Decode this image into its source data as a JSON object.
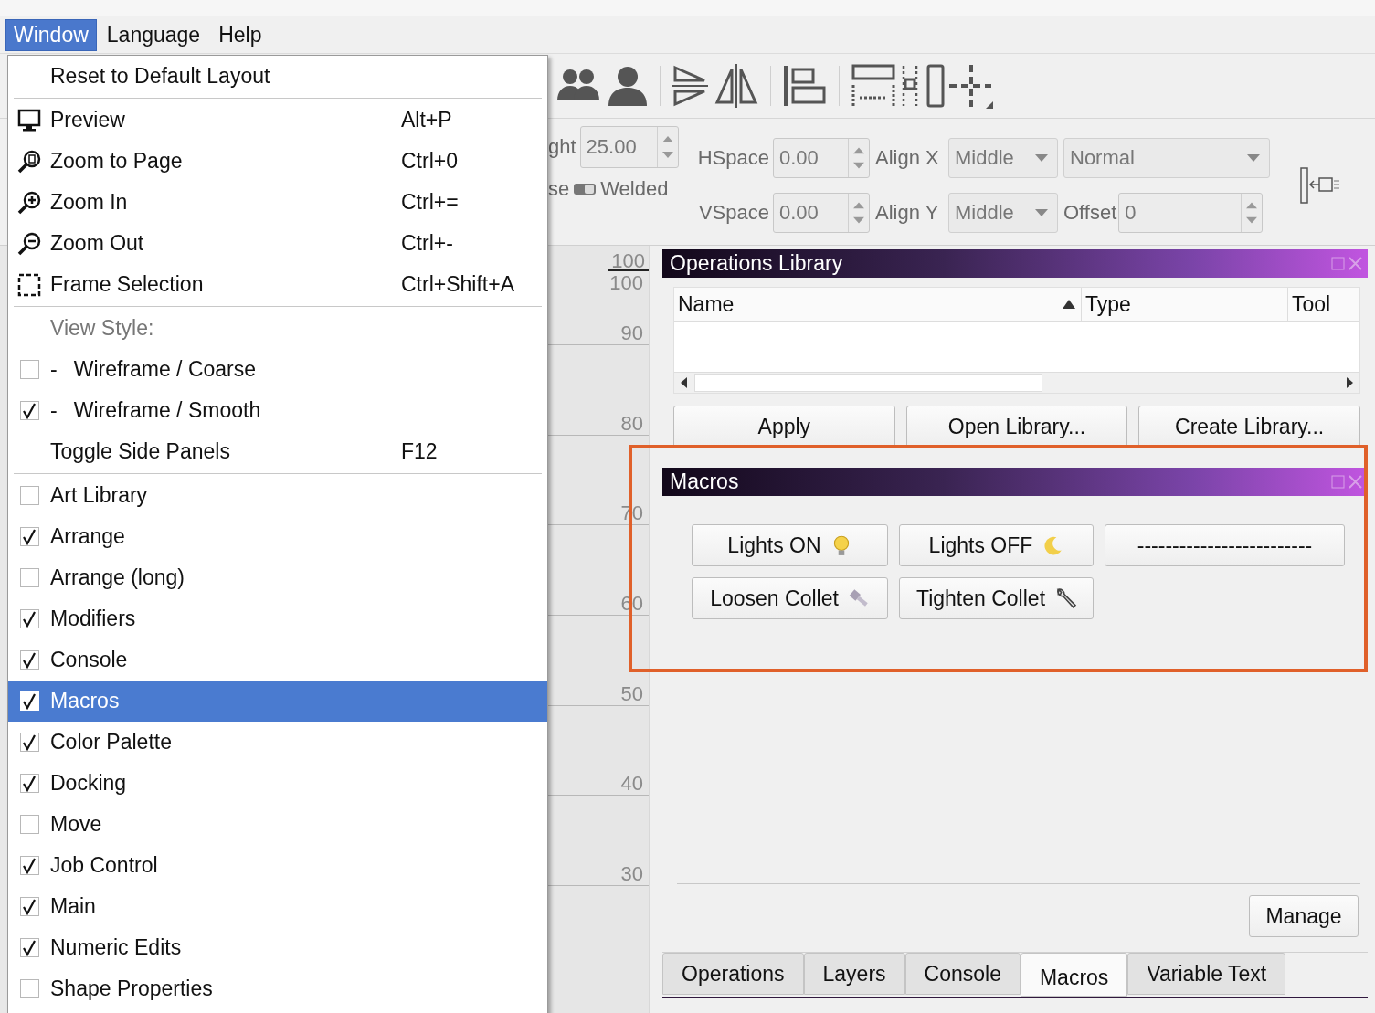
{
  "menubar": [
    {
      "label": "Window",
      "selected": true
    },
    {
      "label": "Language",
      "selected": false
    },
    {
      "label": "Help",
      "selected": false
    }
  ],
  "window_menu": {
    "items": [
      {
        "kind": "action",
        "label": "Reset to Default Layout",
        "selected": false
      },
      {
        "kind": "separator"
      },
      {
        "kind": "action",
        "label": "Preview",
        "shortcut": "Alt+P",
        "selected": false
      },
      {
        "kind": "action",
        "label": "Zoom to Page",
        "shortcut": "Ctrl+0",
        "selected": false
      },
      {
        "kind": "action",
        "label": "Zoom In",
        "shortcut": "Ctrl+=",
        "selected": false
      },
      {
        "kind": "action",
        "label": "Zoom Out",
        "shortcut": "Ctrl+-",
        "selected": false
      },
      {
        "kind": "action",
        "label": "Frame Selection",
        "shortcut": "Ctrl+Shift+A",
        "selected": false
      },
      {
        "kind": "separator"
      },
      {
        "kind": "header",
        "label": "View Style:"
      },
      {
        "kind": "check",
        "prefix": "-",
        "label": "Wireframe / Coarse",
        "checked": false,
        "selected": false
      },
      {
        "kind": "check",
        "prefix": "-",
        "label": "Wireframe / Smooth",
        "checked": true,
        "selected": false
      },
      {
        "kind": "action",
        "label": "Toggle Side Panels",
        "shortcut": "F12",
        "selected": false
      },
      {
        "kind": "separator"
      },
      {
        "kind": "check",
        "label": "Art Library",
        "checked": false,
        "selected": false
      },
      {
        "kind": "check",
        "label": "Arrange",
        "checked": true,
        "selected": false
      },
      {
        "kind": "check",
        "label": "Arrange (long)",
        "checked": false,
        "selected": false
      },
      {
        "kind": "check",
        "label": "Modifiers",
        "checked": true,
        "selected": false
      },
      {
        "kind": "check",
        "label": "Console",
        "checked": true,
        "selected": false
      },
      {
        "kind": "check",
        "label": "Macros",
        "checked": true,
        "selected": true
      },
      {
        "kind": "check",
        "label": "Color Palette",
        "checked": true,
        "selected": false
      },
      {
        "kind": "check",
        "label": "Docking",
        "checked": true,
        "selected": false
      },
      {
        "kind": "check",
        "label": "Move",
        "checked": false,
        "selected": false
      },
      {
        "kind": "check",
        "label": "Job Control",
        "checked": true,
        "selected": false
      },
      {
        "kind": "check",
        "label": "Main",
        "checked": true,
        "selected": false
      },
      {
        "kind": "check",
        "label": "Numeric Edits",
        "checked": true,
        "selected": false
      },
      {
        "kind": "check",
        "label": "Shape Properties",
        "checked": false,
        "selected": false
      }
    ]
  },
  "property_bar": {
    "height": {
      "label": "ght",
      "value": "25.00"
    },
    "weld": {
      "label_start": "se",
      "label": "Welded"
    },
    "hspace": {
      "label": "HSpace",
      "value": "0.00"
    },
    "vspace": {
      "label": "VSpace",
      "value": "0.00"
    },
    "align_x": {
      "label": "Align X",
      "value": "Middle"
    },
    "align_y": {
      "label": "Align Y",
      "value": "Middle"
    },
    "mode": {
      "value": "Normal"
    },
    "offset": {
      "label": "Offset",
      "value": "0"
    }
  },
  "ruler": {
    "labels": [
      "100",
      "100",
      "90",
      "80",
      "70",
      "60",
      "50",
      "40",
      "30"
    ]
  },
  "operations_library": {
    "title": "Operations Library",
    "columns": [
      {
        "label": "Name",
        "sorted": true
      },
      {
        "label": "Type",
        "sorted": false
      },
      {
        "label": "Tool",
        "sorted": false
      }
    ],
    "buttons": [
      "Apply",
      "Open Library...",
      "Create Library..."
    ]
  },
  "macros": {
    "title": "Macros",
    "buttons": [
      {
        "label": "Lights ON"
      },
      {
        "label": "Lights OFF"
      },
      {
        "label": "-------------------------"
      },
      {
        "label": "Loosen Collet"
      },
      {
        "label": "Tighten Collet"
      }
    ],
    "manage_button": "Manage"
  },
  "tabs": [
    {
      "label": "Operations",
      "selected": false
    },
    {
      "label": "Layers",
      "selected": false
    },
    {
      "label": "Console",
      "selected": false
    },
    {
      "label": "Macros",
      "selected": true
    },
    {
      "label": "Variable Text",
      "selected": false
    }
  ]
}
